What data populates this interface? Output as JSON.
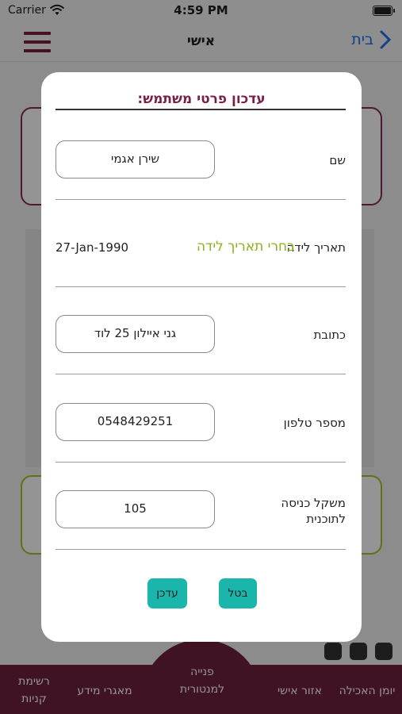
{
  "status_bar": {
    "carrier": "Carrier",
    "time": "4:59 PM"
  },
  "nav_bar": {
    "title": "אישי",
    "back_label": "בית"
  },
  "bottom_nav": {
    "items": [
      {
        "label": "יומן האכילה"
      },
      {
        "label": "אזור אישי"
      },
      {
        "label": "פנייה למנטורית"
      },
      {
        "label": "מאגרי מידע"
      },
      {
        "label": "רשימת קניות"
      }
    ]
  },
  "modal": {
    "title": "עדכון פרטי משתמש:",
    "name_label": "שם",
    "name_value": "שירן אגמי",
    "birthdate_label": "תאריך לידה",
    "birthdate_picker": "בחרי תאריך לידה",
    "birthdate_value": "27-Jan-1990",
    "address_label": "כתובת",
    "address_value": "גני איילון 25 לוד",
    "phone_label": "מספר טלפון",
    "phone_value": "0548429251",
    "weight_label": "משקל כניסה לתוכנית",
    "weight_value": "105",
    "update_button": "עדכן",
    "cancel_button": "בטל"
  },
  "colors": {
    "brand": "#6d1f3e",
    "title": "#7a1f4a",
    "accent_green": "#8ab31c",
    "button": "#1ab6ac",
    "link": "#1a73e8"
  },
  "icons": [
    "wifi-icon",
    "battery-icon",
    "hamburger-menu-icon",
    "chevron-right-icon",
    "instagram-icon",
    "whatsapp-icon",
    "facebook-icon"
  ]
}
